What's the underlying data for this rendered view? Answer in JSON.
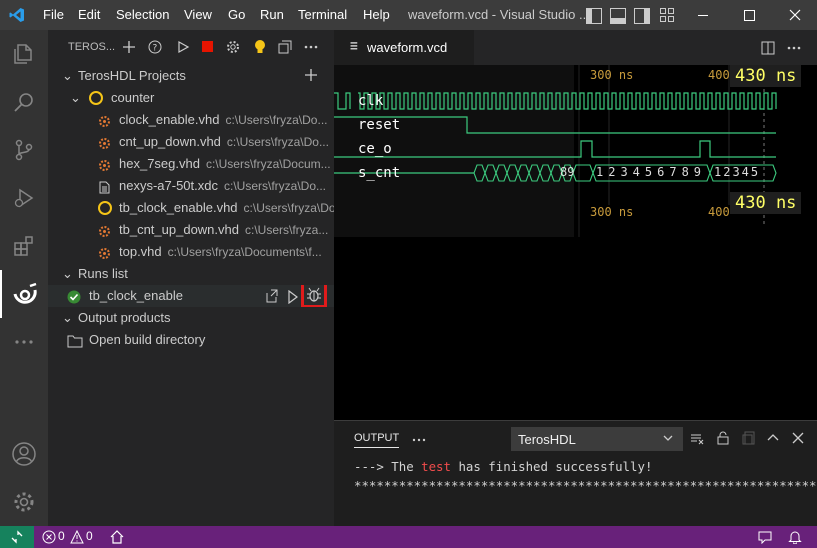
{
  "window": {
    "title": "waveform.vcd - Visual Studio ...",
    "menu": [
      "File",
      "Edit",
      "Selection",
      "View",
      "Go",
      "Run",
      "Terminal",
      "Help"
    ]
  },
  "sidebar": {
    "header": "TEROS...",
    "projects_section": "TerosHDL Projects",
    "project_name": "counter",
    "files": [
      {
        "name": "clock_enable.vhd",
        "path": "c:\\Users\\fryza\\Do..."
      },
      {
        "name": "cnt_up_down.vhd",
        "path": "c:\\Users\\fryza\\Do..."
      },
      {
        "name": "hex_7seg.vhd",
        "path": "c:\\Users\\fryza\\Docum..."
      },
      {
        "name": "nexys-a7-50t.xdc",
        "path": "c:\\Users\\fryza\\Do..."
      },
      {
        "name": "tb_clock_enable.vhd",
        "path": "c:\\Users\\fryza\\Do..."
      },
      {
        "name": "tb_cnt_up_down.vhd",
        "path": "c:\\Users\\fryza..."
      },
      {
        "name": "top.vhd",
        "path": "c:\\Users\\fryza\\Documents\\f..."
      }
    ],
    "runs_section": "Runs list",
    "run_item": "tb_clock_enable",
    "output_section": "Output products",
    "open_build": "Open build directory"
  },
  "editor": {
    "tab_label": "waveform.vcd",
    "signals": [
      "clk",
      "reset",
      "ce_o",
      "s_cnt"
    ],
    "time_300": "300 ns",
    "time_400": "400",
    "cursor_time": "430 ns",
    "cnt_values_a": "89",
    "cnt_values_b": "123456789",
    "cnt_values_c": "12345"
  },
  "panel": {
    "tab": "OUTPUT",
    "channel": "TerosHDL",
    "line1_prefix": "---> The ",
    "line1_word": "test",
    "line1_suffix": " has finished successfully!",
    "line2": "******************************************************************************"
  },
  "status": {
    "errors": "0",
    "warnings": "0"
  },
  "colors": {
    "wave_green": "#3ccb7f",
    "cursor_yellow": "#ffff66",
    "highlight_red": "#e01b1b",
    "status_purple": "#68217a"
  }
}
